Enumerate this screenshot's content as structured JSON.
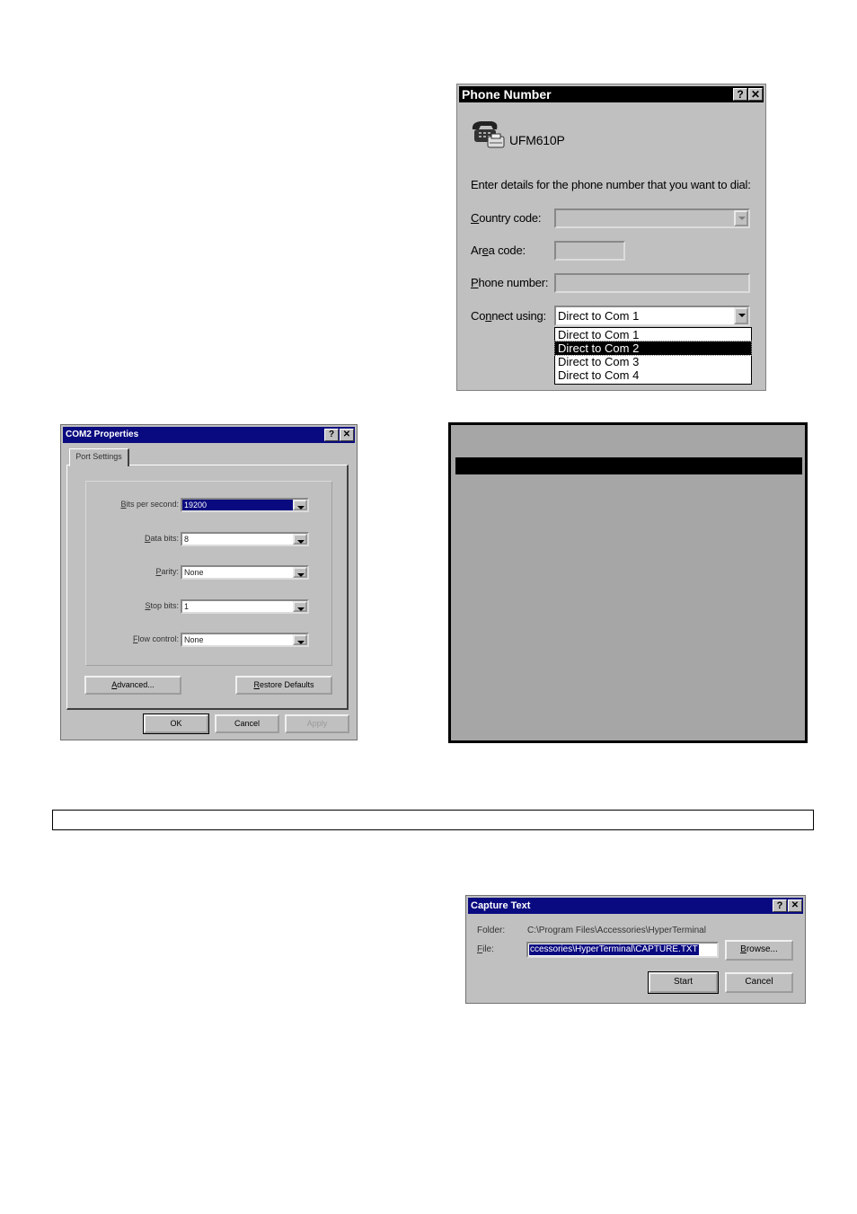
{
  "phone_dialog": {
    "title": "Phone Number",
    "help_glyph": "?",
    "close_glyph": "✕",
    "connection_name": "UFM610P",
    "instruction": "Enter details for the phone number that you want to dial:",
    "country_code": {
      "label_prefix": "",
      "label_ul": "C",
      "label_rest": "ountry code:",
      "value": ""
    },
    "area_code": {
      "label_prefix": "Ar",
      "label_ul": "e",
      "label_rest": "a code:",
      "value": ""
    },
    "phone_number": {
      "label_prefix": "",
      "label_ul": "P",
      "label_rest": "hone number:",
      "value": ""
    },
    "connect_using": {
      "label_prefix": "Co",
      "label_ul": "n",
      "label_rest": "nect using:",
      "value": "Direct to Com 1",
      "options": [
        "Direct to Com 1",
        "Direct to Com 2",
        "Direct to Com 3",
        "Direct to Com 4"
      ],
      "highlighted_index": 1
    }
  },
  "com2_dialog": {
    "title": "COM2 Properties",
    "help_glyph": "?",
    "close_glyph": "✕",
    "tab": "Port Settings",
    "fields": [
      {
        "label_ul": "B",
        "label_rest": "its per second:",
        "value": "19200",
        "selected": true
      },
      {
        "label_ul": "D",
        "label_rest": "ata bits:",
        "value": "8",
        "selected": false
      },
      {
        "label_ul": "P",
        "label_rest": "arity:",
        "value": "None",
        "selected": false
      },
      {
        "label_ul": "S",
        "label_rest": "top bits:",
        "value": "1",
        "selected": false
      },
      {
        "label_ul": "F",
        "label_rest": "low control:",
        "value": "None",
        "selected": false
      }
    ],
    "advanced_ul": "A",
    "advanced_rest": "dvanced...",
    "restore_ul": "R",
    "restore_rest": "estore Defaults",
    "ok": "OK",
    "cancel": "Cancel",
    "apply": "Apply"
  },
  "capture_dialog": {
    "title": "Capture Text",
    "help_glyph": "?",
    "close_glyph": "✕",
    "folder_label": "Folder:",
    "folder_value": "C:\\Program Files\\Accessories\\HyperTerminal",
    "file_label_ul": "F",
    "file_label_rest": "ile:",
    "file_value": "ccessories\\HyperTerminal\\CAPTURE.TXT",
    "browse_ul": "B",
    "browse_rest": "rowse...",
    "start": "Start",
    "cancel": "Cancel"
  },
  "colors": {
    "win_face": "#c0c0c0",
    "title_active_blue": "#0a0a80",
    "terminal_grey": "#a6a6a6"
  }
}
